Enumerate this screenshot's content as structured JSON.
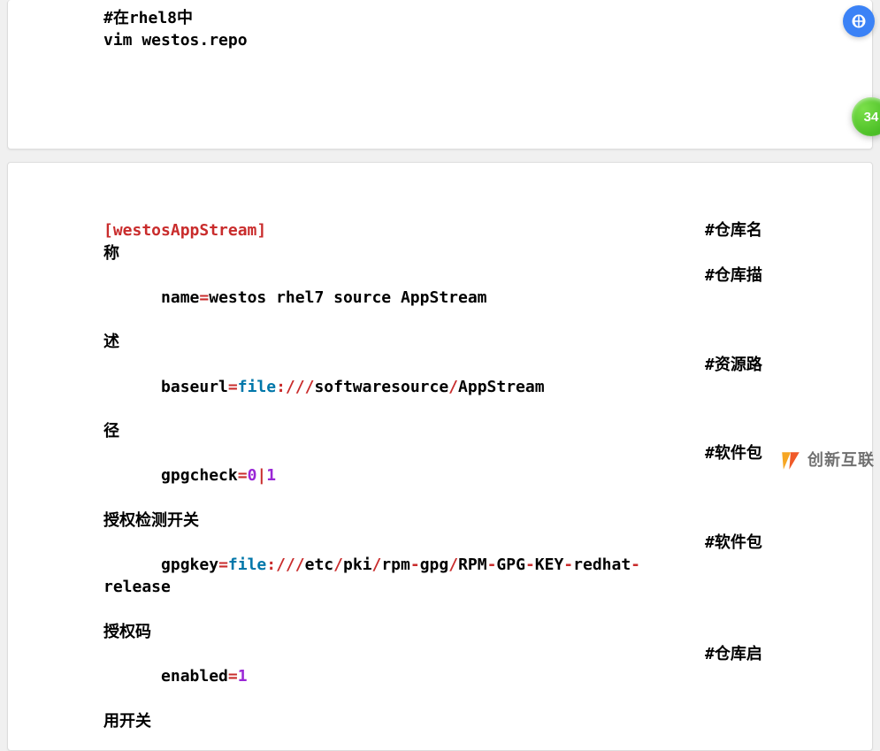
{
  "top_card": {
    "line1_comment": "#在rhel8中",
    "line2_cmd": "vim westos.repo"
  },
  "bottom_card": {
    "l1_code": "[westosAppStream]",
    "l1_cmt": "#仓库名",
    "l1_wrap": "称",
    "l2_lhs": "name",
    "l2_rhs": "westos rhel7 source AppStream",
    "l2_cmt": "#仓库描",
    "l2_wrap": "述",
    "l3_lhs": "baseurl",
    "l3_proto": "file",
    "l3_slashes": ":///",
    "l3_seg1": "softwaresource",
    "l3_slash1": "/",
    "l3_seg2": "AppStream",
    "l3_cmt": "#资源路",
    "l3_wrap": "径",
    "l4_lhs": "gpgcheck",
    "l4_v0": "0",
    "l4_pipe": "|",
    "l4_v1": "1",
    "l4_cmt": "#软件包",
    "l4_wrap": "授权检测开关",
    "l5_lhs": "gpgkey",
    "l5_proto": "file",
    "l5_slashes": ":///",
    "l5_seg1": "etc",
    "l5_s1": "/",
    "l5_seg2": "pki",
    "l5_s2": "/",
    "l5_seg3": "rpm",
    "l5_d1": "-",
    "l5_seg4": "gpg",
    "l5_s3": "/",
    "l5_seg5": "RPM",
    "l5_d2": "-",
    "l5_seg6": "GPG",
    "l5_d3": "-",
    "l5_seg7": "KEY",
    "l5_d4": "-",
    "l5_seg8": "redhat",
    "l5_d5": "-",
    "l5_seg9": "release",
    "l5_cmt": "#软件包",
    "l5_wrap": "授权码",
    "l6_lhs": "enabled",
    "l6_val": "1",
    "l6_cmt": "#仓库启",
    "l6_wrap": "用开关"
  },
  "floating": {
    "badge_text": "34",
    "logo_text": "创新互联"
  }
}
